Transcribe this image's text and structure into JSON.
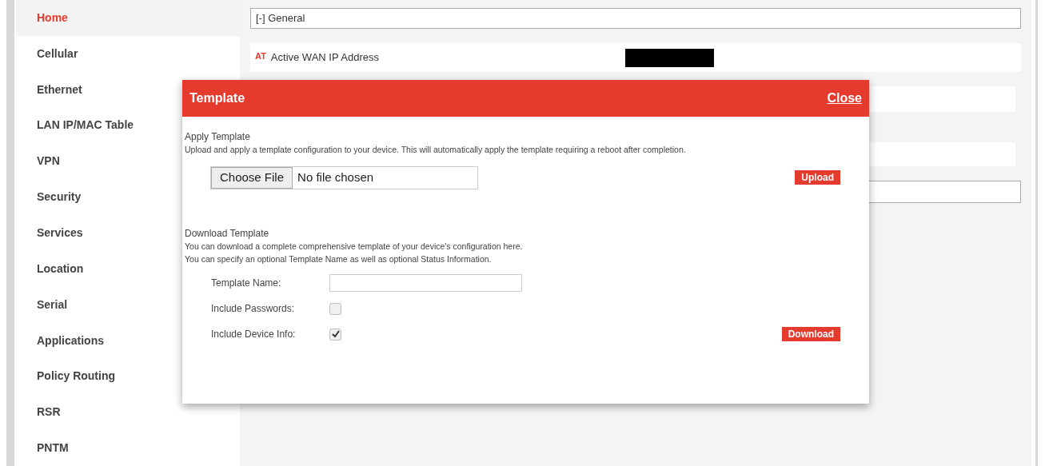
{
  "sidebar": {
    "items": [
      {
        "label": "Home",
        "selected": true
      },
      {
        "label": "Cellular",
        "selected": false
      },
      {
        "label": "Ethernet",
        "selected": false
      },
      {
        "label": "LAN IP/MAC Table",
        "selected": false
      },
      {
        "label": "VPN",
        "selected": false
      },
      {
        "label": "Security",
        "selected": false
      },
      {
        "label": "Services",
        "selected": false
      },
      {
        "label": "Location",
        "selected": false
      },
      {
        "label": "Serial",
        "selected": false
      },
      {
        "label": "Applications",
        "selected": false
      },
      {
        "label": "Policy Routing",
        "selected": false
      },
      {
        "label": "RSR",
        "selected": false
      },
      {
        "label": "PNTM",
        "selected": false
      }
    ]
  },
  "main": {
    "section_header": "[-] General",
    "rows": [
      {
        "badge": "AT",
        "label": "Active WAN IP Address"
      }
    ]
  },
  "dialog": {
    "title": "Template",
    "close": "Close",
    "apply": {
      "heading": "Apply Template",
      "description": "Upload and apply a template configuration to your device. This will automatically apply the template requiring a reboot after completion.",
      "choose_button": "Choose File",
      "file_status": "No file chosen",
      "upload_button": "Upload"
    },
    "download": {
      "heading": "Download Template",
      "description_lines": [
        "You can download a complete comprehensive template of your device's configuration here.",
        "You can specify an optional Template Name as well as optional Status Information."
      ],
      "fields": [
        {
          "kind": "text",
          "label": "Template Name:"
        },
        {
          "kind": "checkbox",
          "label": "Include Passwords:",
          "checked": false
        },
        {
          "kind": "checkbox",
          "label": "Include Device Info:",
          "checked": true
        }
      ],
      "download_button": "Download"
    }
  }
}
